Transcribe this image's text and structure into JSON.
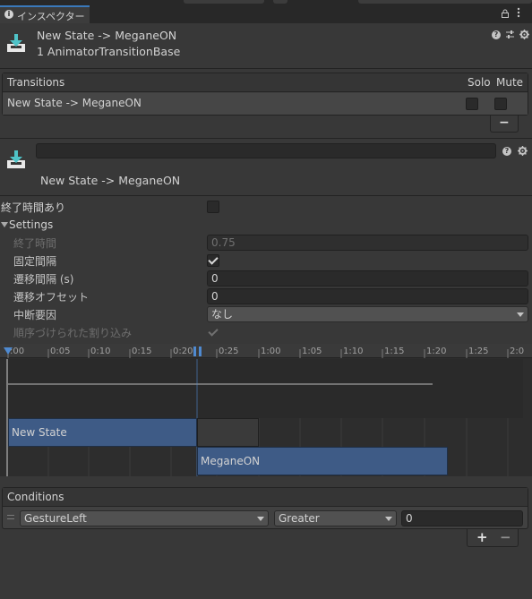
{
  "tab": {
    "icon": "info-icon",
    "label": "インスペクター",
    "accent": "#3a79bb"
  },
  "header": {
    "title": "New State -> MeganeON",
    "subtitle": "1 AnimatorTransitionBase"
  },
  "transitions": {
    "heading": "Transitions",
    "col_solo": "Solo",
    "col_mute": "Mute",
    "row_label": "New State -> MeganeON",
    "remove_label": "−"
  },
  "transition_header": {
    "name_value": "",
    "title": "New State -> MeganeON"
  },
  "settings": {
    "has_exit_time_label": "終了時間あり",
    "foldout_label": "Settings",
    "exit_time_label": "終了時間",
    "exit_time_value": "0.75",
    "fixed_duration_label": "固定間隔",
    "duration_label": "遷移間隔 (s)",
    "duration_value": "0",
    "offset_label": "遷移オフセット",
    "offset_value": "0",
    "interruption_label": "中断要因",
    "interruption_value": "なし",
    "ordered_label": "順序づけられた割り込み"
  },
  "timeline": {
    "ticks": [
      ":00",
      "0:05",
      "0:10",
      "0:15",
      "0:20",
      "0:25",
      "1:00",
      "1:05",
      "1:10",
      "1:15",
      "1:20",
      "1:25",
      "2:0"
    ],
    "source_state": "New State",
    "dest_state": "MeganeON",
    "state_color": "#3e5b86",
    "cursor_color": "#4f8ad0"
  },
  "conditions": {
    "heading": "Conditions",
    "parameter": "GestureLeft",
    "mode": "Greater",
    "threshold": "0",
    "add_label": "+",
    "remove_label": "−"
  }
}
